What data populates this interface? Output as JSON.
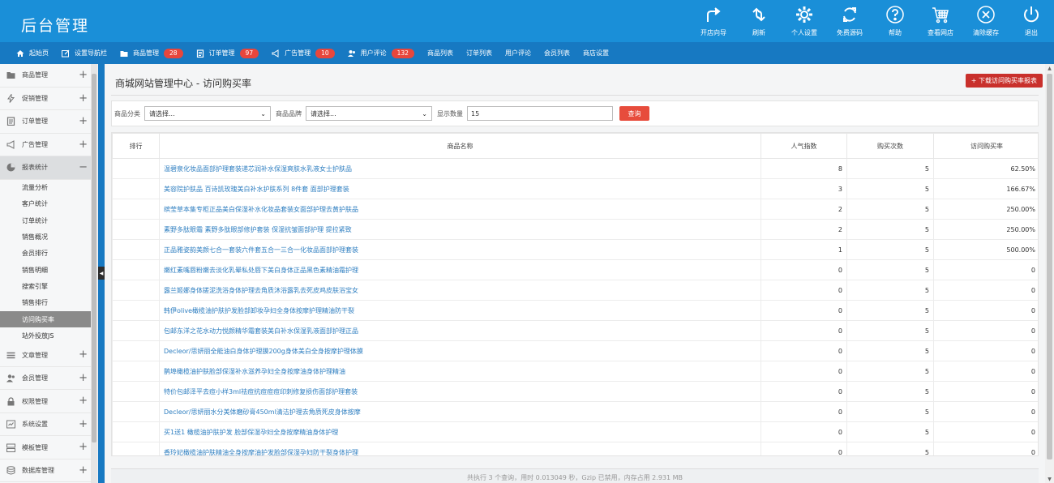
{
  "header": {
    "logo": "后台管理",
    "actions": [
      {
        "label": "开店向导",
        "icon": "share-arrow-icon"
      },
      {
        "label": "刷新",
        "icon": "refresh-icon"
      },
      {
        "label": "个人设置",
        "icon": "gear-icon"
      },
      {
        "label": "免费源码",
        "icon": "sync-icon"
      },
      {
        "label": "帮助",
        "icon": "help-icon"
      },
      {
        "label": "查看网店",
        "icon": "cart-icon"
      },
      {
        "label": "清除缓存",
        "icon": "close-circle-icon"
      },
      {
        "label": "退出",
        "icon": "power-icon"
      }
    ]
  },
  "nav": {
    "items": [
      {
        "label": "起始页",
        "icon": "home-icon",
        "badge": ""
      },
      {
        "label": "设置导航栏",
        "icon": "edit-icon",
        "badge": ""
      },
      {
        "label": "商品管理",
        "icon": "folder-icon",
        "badge": "28"
      },
      {
        "label": "订单管理",
        "icon": "order-icon",
        "badge": "97"
      },
      {
        "label": "广告管理",
        "icon": "megaphone-icon",
        "badge": "10"
      },
      {
        "label": "用户评论",
        "icon": "users-icon",
        "badge": "132"
      },
      {
        "label": "商品列表",
        "icon": "",
        "badge": ""
      },
      {
        "label": "订单列表",
        "icon": "",
        "badge": ""
      },
      {
        "label": "用户评论",
        "icon": "",
        "badge": ""
      },
      {
        "label": "会员列表",
        "icon": "",
        "badge": ""
      },
      {
        "label": "商店设置",
        "icon": "",
        "badge": ""
      }
    ]
  },
  "sidebar": {
    "groups_top": [
      {
        "label": "商品管理",
        "icon": "folder-icon",
        "toggle": "+"
      },
      {
        "label": "促销管理",
        "icon": "flash-icon",
        "toggle": "+"
      },
      {
        "label": "订单管理",
        "icon": "order-icon",
        "toggle": "+"
      },
      {
        "label": "广告管理",
        "icon": "megaphone-icon",
        "toggle": "+"
      },
      {
        "label": "报表统计",
        "icon": "pie-chart-icon",
        "toggle": "−"
      }
    ],
    "sub_items": [
      "流量分析",
      "客户统计",
      "订单统计",
      "销售概况",
      "会员排行",
      "销售明细",
      "搜索引擎",
      "销售排行",
      "访问购买率",
      "站外投放JS"
    ],
    "active_sub": "访问购买率",
    "groups_bottom": [
      {
        "label": "文章管理",
        "icon": "list-icon",
        "toggle": "+"
      },
      {
        "label": "会员管理",
        "icon": "users-icon",
        "toggle": "+"
      },
      {
        "label": "权限管理",
        "icon": "lock-icon",
        "toggle": "+"
      },
      {
        "label": "系统设置",
        "icon": "settings-box-icon",
        "toggle": "+"
      },
      {
        "label": "模板管理",
        "icon": "template-icon",
        "toggle": "+"
      },
      {
        "label": "数据库管理",
        "icon": "database-icon",
        "toggle": "+"
      }
    ]
  },
  "main": {
    "title": "商城网站管理中心 - 访问购买率",
    "download_label": "+ 下载访问购买率报表",
    "filter": {
      "category_label": "商品分类",
      "category_value": "请选择...",
      "brand_label": "商品品牌",
      "brand_value": "请选择...",
      "count_label": "显示数量",
      "count_value": "15",
      "query_label": "查询"
    },
    "table": {
      "headers": [
        "排行",
        "商品名称",
        "人气指数",
        "购买次数",
        "访问购买率"
      ],
      "rows": [
        [
          "",
          "温碧泉化妆品面部护理套装递芯润补水保湿爽肤水乳液女士护肤品",
          "8",
          "5",
          "62.50%"
        ],
        [
          "",
          "美容院护肤品 百诗凯玫瑰美白补水护肤系列 8件套 面部护理套装",
          "3",
          "5",
          "166.67%"
        ],
        [
          "",
          "缤莹草本集专柜正品美白保湿补水化妆品套装女面部护理去黄护肤品",
          "2",
          "5",
          "250.00%"
        ],
        [
          "",
          "素野多肽眼霜 素野多肽眼部修护套装 保湿抗皱面部护理 提拉紧致",
          "2",
          "5",
          "250.00%"
        ],
        [
          "",
          "正品雅姿韵美颜七合一套装六件套五合一三合一化妆品面部护理套装",
          "1",
          "5",
          "500.00%"
        ],
        [
          "",
          "嫩红素嘴唇粉嫩去淡化乳晕私处唇下美白身体正品黑色素精油霜护理",
          "0",
          "5",
          "0"
        ],
        [
          "",
          "露兰姬娜身体搓泥洗浴身体护理去角质沐浴露乳去死皮鸡皮肤浴宝女",
          "0",
          "5",
          "0"
        ],
        [
          "",
          "韩伊olive橄榄油护肤护发脸部卸妆孕妇全身体按摩护理精油防干裂",
          "0",
          "5",
          "0"
        ],
        [
          "",
          "包邮东洋之花水动力悦颜精华霜套装美白补水保湿乳液面部护理正品",
          "0",
          "5",
          "0"
        ],
        [
          "",
          "Decleor/思妍丽全能油白身体护理膜200g身体美白全身按摩护理体膜",
          "0",
          "5",
          "0"
        ],
        [
          "",
          "鹊埠橄榄油护肤脸部保湿补水滋养孕妇全身按摩油身体护理精油",
          "0",
          "5",
          "0"
        ],
        [
          "",
          "特价包邮泽平去痘小样3ml祛痘抗痘痘痘印刺修复损伤面部护理套装",
          "0",
          "5",
          "0"
        ],
        [
          "",
          "Decleor/思妍丽水分美体磨砂膏450ml清洁护理去角质死皮身体按摩",
          "0",
          "5",
          "0"
        ],
        [
          "",
          "买1送1 橄榄油护肤护发 脸部保湿孕妇全身按摩精油身体护理",
          "0",
          "5",
          "0"
        ],
        [
          "",
          "香玲妃橄榄油护肤精油全身按摩油护发脸部保湿孕妇防干裂身体护理",
          "0",
          "5",
          "0"
        ]
      ]
    },
    "footer": "共执行 3 个查询，用时 0.013049 秒，Gzip 已禁用，内存占用 2.931 MB"
  }
}
